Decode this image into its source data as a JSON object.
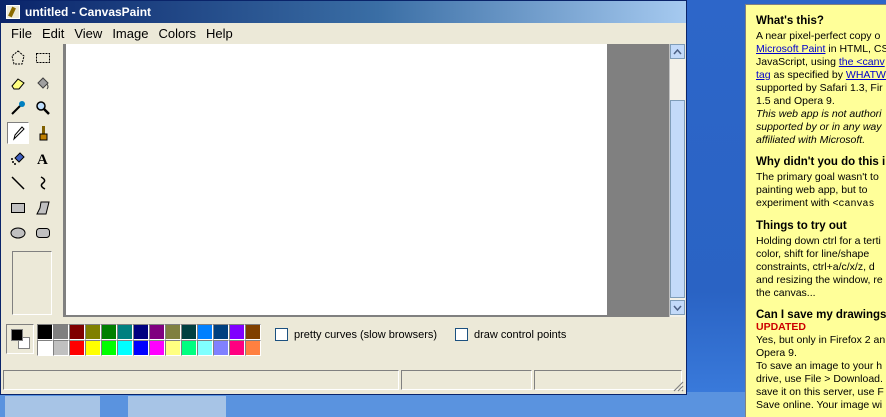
{
  "window": {
    "title": "untitled - CanvasPaint",
    "menu": [
      "File",
      "Edit",
      "View",
      "Image",
      "Colors",
      "Help"
    ]
  },
  "tools": [
    {
      "name": "free-select-icon"
    },
    {
      "name": "rect-select-icon"
    },
    {
      "name": "eraser-icon"
    },
    {
      "name": "fill-bucket-icon"
    },
    {
      "name": "color-picker-icon"
    },
    {
      "name": "magnifier-icon"
    },
    {
      "name": "pencil-icon",
      "active": true
    },
    {
      "name": "brush-icon"
    },
    {
      "name": "airbrush-icon"
    },
    {
      "name": "text-icon"
    },
    {
      "name": "line-icon"
    },
    {
      "name": "curve-icon"
    },
    {
      "name": "rectangle-icon"
    },
    {
      "name": "polygon-icon"
    },
    {
      "name": "ellipse-icon"
    },
    {
      "name": "rounded-rect-icon"
    }
  ],
  "palette": {
    "foreground": "#000000",
    "background": "#ffffff",
    "colors": [
      "#000000",
      "#808080",
      "#800000",
      "#808000",
      "#008000",
      "#008080",
      "#000080",
      "#800080",
      "#808040",
      "#004040",
      "#0080ff",
      "#004080",
      "#8000ff",
      "#804000",
      "#ffffff",
      "#c0c0c0",
      "#ff0000",
      "#ffff00",
      "#00ff00",
      "#00ffff",
      "#0000ff",
      "#ff00ff",
      "#ffff80",
      "#00ff80",
      "#80ffff",
      "#8080ff",
      "#ff0080",
      "#ff8040"
    ],
    "options": {
      "pretty_curves": "pretty curves (slow browsers)",
      "control_points": "draw control points"
    }
  },
  "side": {
    "whats_this": {
      "title": "What's this?",
      "l1": "A near pixel-perfect copy o",
      "l2_link": "Microsoft Paint",
      "l2_rest": " in HTML, CS",
      "l3_pre": "JavaScript, using ",
      "l3_link": "the <canv",
      "l4_link": "tag",
      "l4_mid": " as specified by ",
      "l4_link2": "WHATW",
      "l5": "supported by Safari 1.3, Fir",
      "l6": "1.5 and Opera 9.",
      "l7": "This web app is not authori",
      "l8": "supported by or in any way",
      "l9": "affiliated with Microsoft."
    },
    "why": {
      "title": "Why didn't you do this i",
      "l1": "The primary goal wasn't to",
      "l2": "painting web app, but to",
      "l3_pre": "experiment with ",
      "l3_code": "<canvas"
    },
    "try": {
      "title": "Things to try out",
      "l1": "Holding down ctrl for a terti",
      "l2": "color, shift for line/shape",
      "l3": "constraints, ctrl+a/c/x/z, d",
      "l4": "and resizing the window, re",
      "l5": "the canvas..."
    },
    "save": {
      "title": "Can I save my drawings",
      "updated": "UPDATED",
      "l1": "Yes, but only in Firefox 2 an",
      "l2": "Opera 9.",
      "l3": "To save an image to your h",
      "l4": "drive, use File > Download.",
      "l5": "save it on this server, use F",
      "l6": "Save online. Your image wi"
    }
  }
}
